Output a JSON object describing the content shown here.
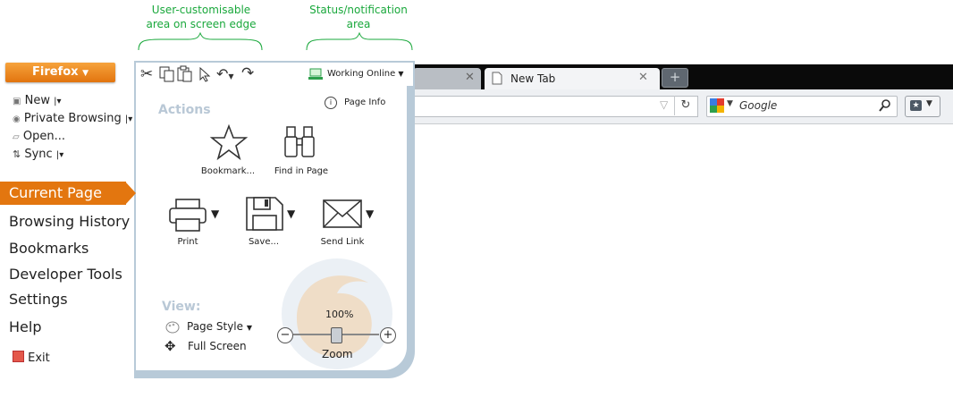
{
  "annotations": {
    "left": "User-customisable area on screen edge",
    "right": "Status/notification area"
  },
  "browser": {
    "new_tab_label": "New Tab",
    "search_placeholder": "Google",
    "new_tab_button": "+"
  },
  "menu": {
    "firefox_button": "Firefox",
    "new": "New",
    "private_browsing": "Private Browsing",
    "open": "Open...",
    "sync": "Sync",
    "current_page": "Current Page",
    "browsing_history": "Browsing History",
    "bookmarks": "Bookmarks",
    "developer_tools": "Developer Tools",
    "settings": "Settings",
    "help": "Help",
    "exit": "Exit"
  },
  "panel": {
    "working_online": "Working Online",
    "page_info": "Page Info",
    "actions": "Actions",
    "bookmark": "Bookmark...",
    "find_in_page": "Find in Page",
    "print": "Print",
    "save": "Save...",
    "send_link": "Send Link",
    "view": "View:",
    "page_style": "Page Style",
    "full_screen": "Full Screen",
    "zoom_percent": "100%",
    "zoom_label": "Zoom",
    "zoom_level": 1.0
  },
  "colors": {
    "accent": "#e3760f",
    "annotation": "#1aa83c",
    "panel_border": "#b8cad8"
  }
}
